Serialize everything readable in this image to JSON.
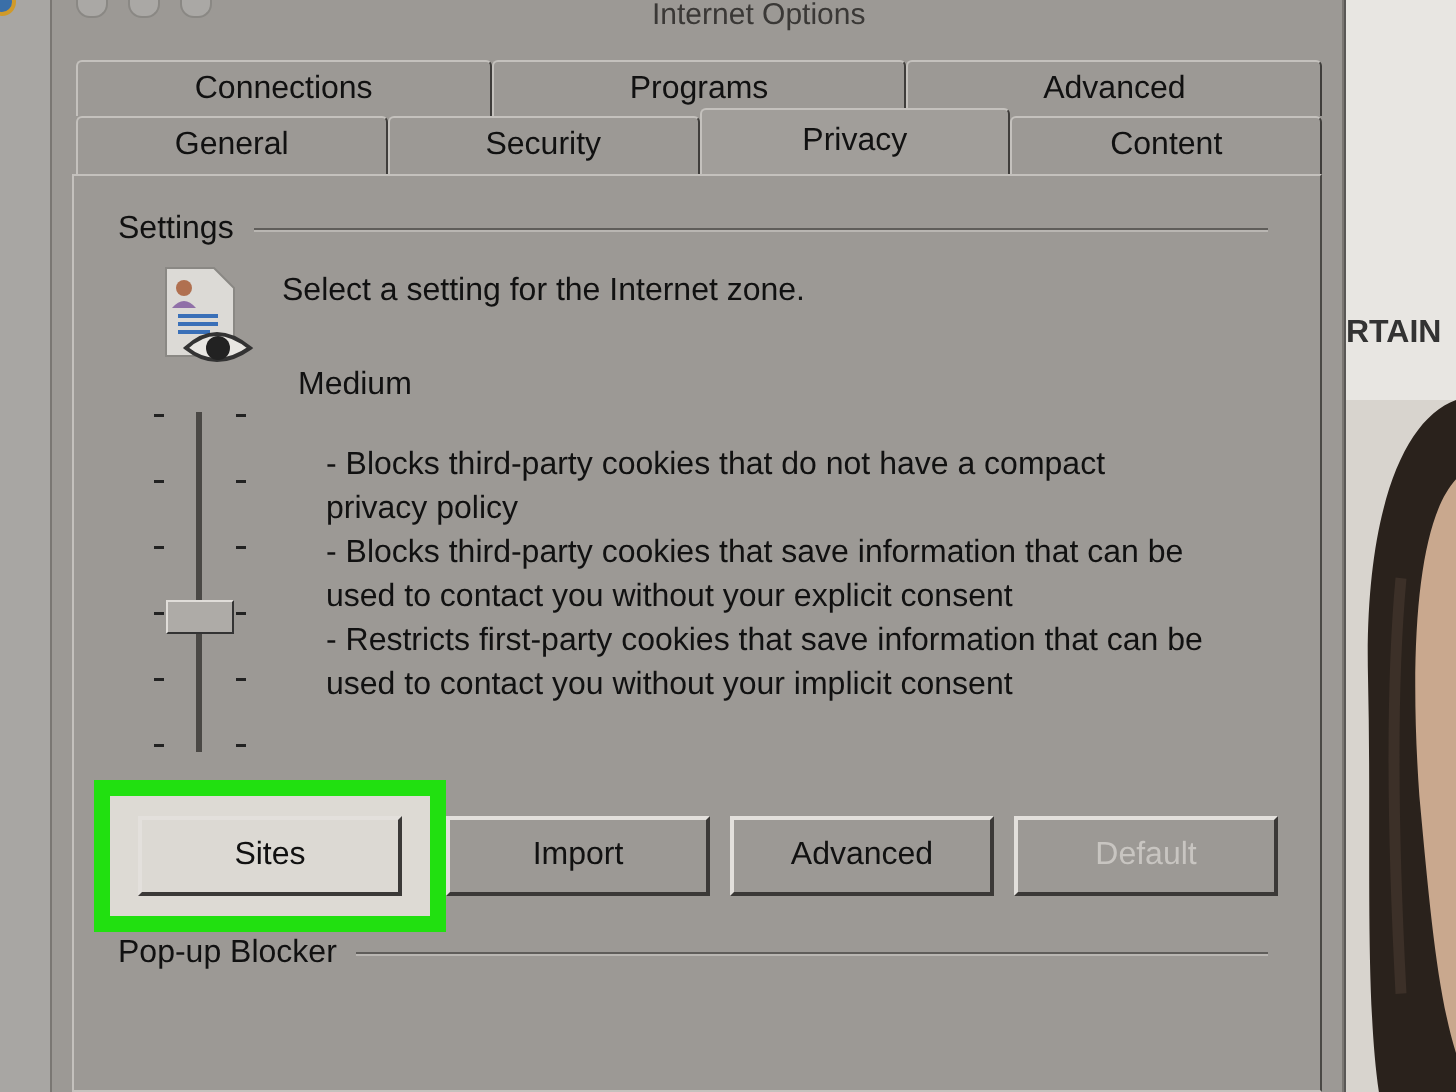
{
  "window": {
    "title": "Internet Options"
  },
  "tab_rows": [
    [
      {
        "label": "Connections",
        "selected": false
      },
      {
        "label": "Programs",
        "selected": false
      },
      {
        "label": "Advanced",
        "selected": false
      }
    ],
    [
      {
        "label": "General",
        "selected": false
      },
      {
        "label": "Security",
        "selected": false
      },
      {
        "label": "Privacy",
        "selected": true
      },
      {
        "label": "Content",
        "selected": false
      }
    ]
  ],
  "settings": {
    "heading": "Settings",
    "intro": "Select a setting for the Internet zone.",
    "slider": {
      "level": 0.4
    },
    "level_name": "Medium",
    "description": [
      "- Blocks third-party cookies that do not have a compact privacy policy",
      "- Blocks third-party cookies that save information that can be used to contact you without your explicit consent",
      "- Restricts first-party cookies that save information that can be used to contact you without your implicit consent"
    ]
  },
  "buttons": [
    {
      "label": "Sites",
      "disabled": false,
      "highlighted": true
    },
    {
      "label": "Import",
      "disabled": false,
      "highlighted": false
    },
    {
      "label": "Advanced",
      "disabled": false,
      "highlighted": false
    },
    {
      "label": "Default",
      "disabled": true,
      "highlighted": false
    }
  ],
  "popup_blocker": {
    "heading": "Pop-up Blocker"
  },
  "background": {
    "heading": "RTAIN",
    "kind": "picture"
  }
}
